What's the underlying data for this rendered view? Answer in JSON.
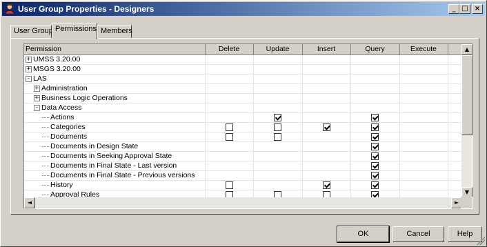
{
  "window": {
    "title": "User Group Properties - Designers",
    "buttons": {
      "minimize": "_",
      "maximize": "□",
      "close": "×"
    }
  },
  "tabs": [
    {
      "label": "User Group"
    },
    {
      "label": "Permissions"
    },
    {
      "label": "Members"
    }
  ],
  "grid": {
    "columns": [
      "Permission",
      "Delete",
      "Update",
      "Insert",
      "Query",
      "Execute"
    ],
    "rows": [
      {
        "label": "UMSS 3.20.00",
        "level": 0,
        "expander": "+",
        "delete": null,
        "update": null,
        "insert": null,
        "query": null,
        "execute": null
      },
      {
        "label": "MSGS 3.20.00",
        "level": 0,
        "expander": "+",
        "delete": null,
        "update": null,
        "insert": null,
        "query": null,
        "execute": null
      },
      {
        "label": "LAS",
        "level": 0,
        "expander": "-",
        "delete": null,
        "update": null,
        "insert": null,
        "query": null,
        "execute": null
      },
      {
        "label": "Administration",
        "level": 1,
        "expander": "+",
        "delete": null,
        "update": null,
        "insert": null,
        "query": null,
        "execute": null
      },
      {
        "label": "Business Logic Operations",
        "level": 1,
        "expander": "+",
        "delete": null,
        "update": null,
        "insert": null,
        "query": null,
        "execute": null
      },
      {
        "label": "Data Access",
        "level": 1,
        "expander": "-",
        "delete": null,
        "update": null,
        "insert": null,
        "query": null,
        "execute": null
      },
      {
        "label": "Actions",
        "level": 2,
        "expander": "",
        "delete": null,
        "update": true,
        "insert": null,
        "query": true,
        "execute": null
      },
      {
        "label": "Categories",
        "level": 2,
        "expander": "",
        "delete": false,
        "update": false,
        "insert": true,
        "query": true,
        "execute": null
      },
      {
        "label": "Documents",
        "level": 2,
        "expander": "",
        "delete": false,
        "update": false,
        "insert": null,
        "query": true,
        "execute": null
      },
      {
        "label": "Documents in Design State",
        "level": 2,
        "expander": "",
        "delete": null,
        "update": null,
        "insert": null,
        "query": true,
        "execute": null
      },
      {
        "label": "Documents in Seeking Approval State",
        "level": 2,
        "expander": "",
        "delete": null,
        "update": null,
        "insert": null,
        "query": true,
        "execute": null
      },
      {
        "label": "Documents in Final State - Last version",
        "level": 2,
        "expander": "",
        "delete": null,
        "update": null,
        "insert": null,
        "query": true,
        "execute": null
      },
      {
        "label": "Documents in Final State - Previous versions",
        "level": 2,
        "expander": "",
        "delete": null,
        "update": null,
        "insert": null,
        "query": true,
        "execute": null
      },
      {
        "label": "History",
        "level": 2,
        "expander": "",
        "delete": false,
        "update": null,
        "insert": true,
        "query": true,
        "execute": null
      },
      {
        "label": "Approval Rules",
        "level": 2,
        "expander": "",
        "delete": false,
        "update": false,
        "insert": false,
        "query": true,
        "execute": null
      }
    ]
  },
  "scroll": {
    "up": "▲",
    "down": "▼",
    "left": "◄",
    "right": "►"
  },
  "footer": {
    "ok": "OK",
    "cancel": "Cancel",
    "help": "Help"
  }
}
